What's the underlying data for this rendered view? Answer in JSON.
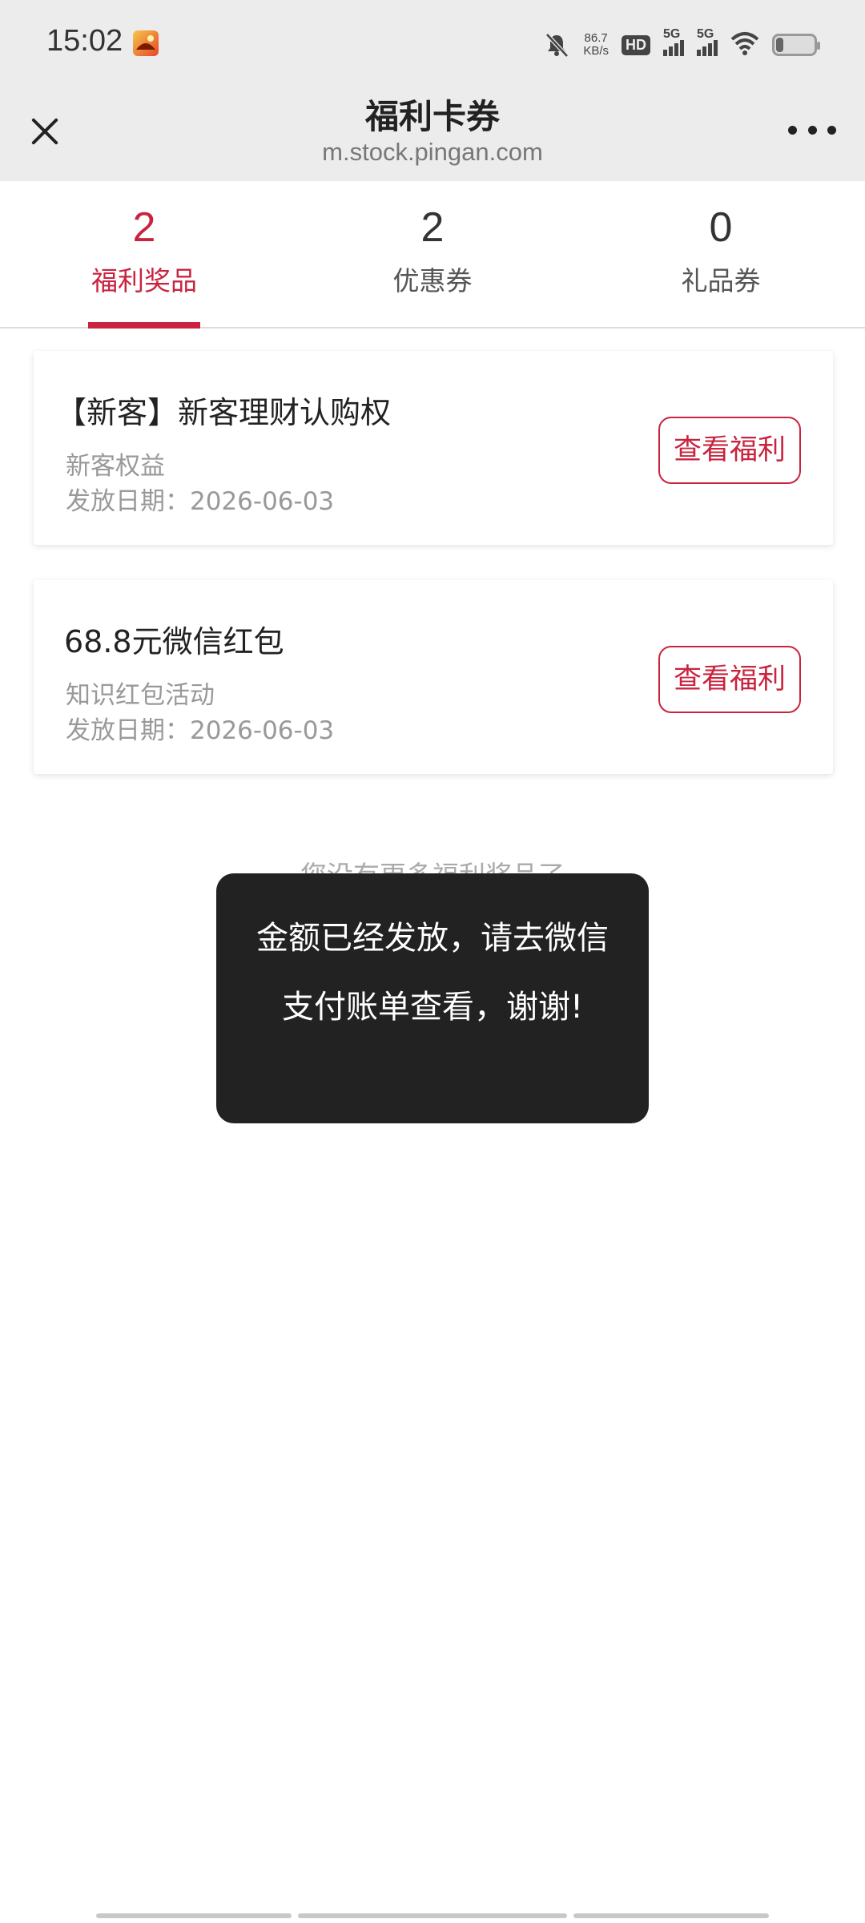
{
  "status_bar": {
    "time": "15:02",
    "network_speed_value": "86.7",
    "network_speed_unit": "KB/s",
    "hd_label": "HD",
    "sim1_label": "5G",
    "sim2_label": "5G",
    "battery_level": 0.2
  },
  "nav": {
    "title": "福利卡券",
    "url": "m.stock.pingan.com"
  },
  "tabs": [
    {
      "count": "2",
      "label": "福利奖品",
      "active": true
    },
    {
      "count": "2",
      "label": "优惠券",
      "active": false
    },
    {
      "count": "0",
      "label": "礼品券",
      "active": false
    }
  ],
  "cards": [
    {
      "title": "【新客】新客理财认购权",
      "subtitle": "新客权益",
      "date_label": "发放日期：",
      "date": "2026-06-03",
      "button_label": "查看福利"
    },
    {
      "title": "68.8元微信红包",
      "subtitle": "知识红包活动",
      "date_label": "发放日期：",
      "date": "2026-06-03",
      "button_label": "查看福利"
    }
  ],
  "end_text": "您没有更多福利奖品了",
  "toast": {
    "text": "金额已经发放，请去微信支付账单查看，谢谢!"
  },
  "colors": {
    "accent": "#c9243f",
    "toast_bg": "#222222",
    "header_bg": "#ececec"
  }
}
